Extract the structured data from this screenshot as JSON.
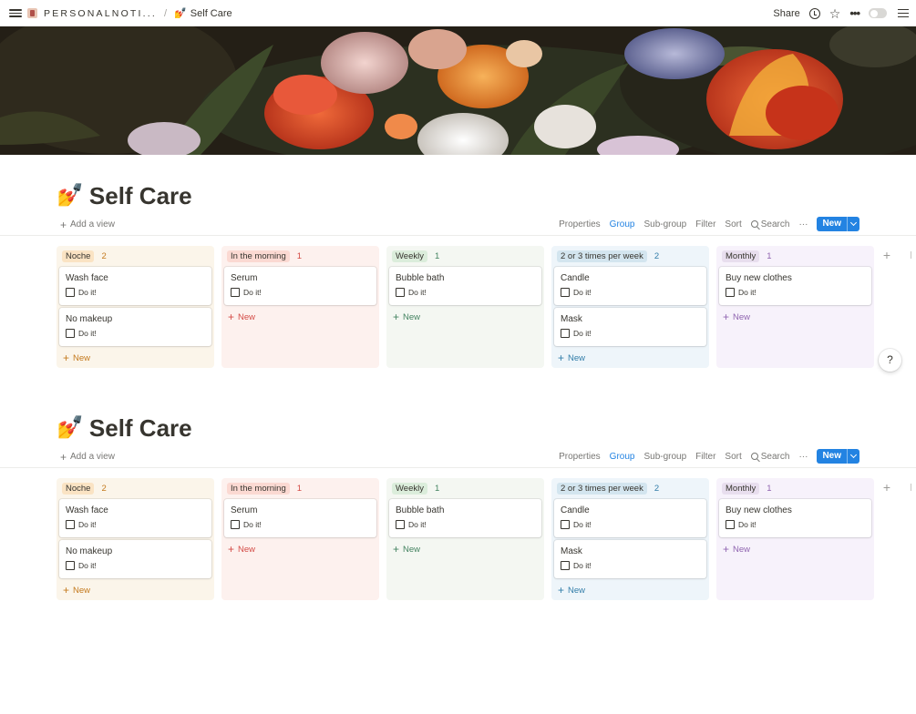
{
  "topbar": {
    "workspace": "PERSONALNOTI...",
    "separator": "/",
    "page_emoji": "💅",
    "page": "Self Care",
    "share": "Share",
    "more": "•••"
  },
  "sections": [
    {
      "emoji": "💅",
      "title": "Self Care",
      "add_view": "Add a view",
      "toolbar": {
        "properties": "Properties",
        "group": "Group",
        "subgroup": "Sub-group",
        "filter": "Filter",
        "sort": "Sort",
        "search": "Search",
        "more": "···",
        "new": "New"
      },
      "columns": [
        {
          "name": "Noche",
          "count": "2",
          "cards": [
            {
              "name": "Wash face",
              "check": "Do it!"
            },
            {
              "name": "No makeup",
              "check": "Do it!"
            }
          ],
          "new": "New"
        },
        {
          "name": "In the morning",
          "count": "1",
          "cards": [
            {
              "name": "Serum",
              "check": "Do it!"
            }
          ],
          "new": "New"
        },
        {
          "name": "Weekly",
          "count": "1",
          "cards": [
            {
              "name": "Bubble bath",
              "check": "Do it!"
            }
          ],
          "new": "New"
        },
        {
          "name": "2 or 3 times per week",
          "count": "2",
          "cards": [
            {
              "name": "Candle",
              "check": "Do it!"
            },
            {
              "name": "Mask",
              "check": "Do it!"
            }
          ],
          "new": "New"
        },
        {
          "name": "Monthly",
          "count": "1",
          "cards": [
            {
              "name": "Buy new clothes",
              "check": "Do it!"
            }
          ],
          "new": "New"
        }
      ]
    },
    {
      "emoji": "💅",
      "title": "Self Care",
      "add_view": "Add a view",
      "toolbar": {
        "properties": "Properties",
        "group": "Group",
        "subgroup": "Sub-group",
        "filter": "Filter",
        "sort": "Sort",
        "search": "Search",
        "more": "···",
        "new": "New"
      },
      "columns": [
        {
          "name": "Noche",
          "count": "2",
          "cards": [
            {
              "name": "Wash face",
              "check": "Do it!"
            },
            {
              "name": "No makeup",
              "check": "Do it!"
            }
          ],
          "new": "New"
        },
        {
          "name": "In the morning",
          "count": "1",
          "cards": [
            {
              "name": "Serum",
              "check": "Do it!"
            }
          ],
          "new": "New"
        },
        {
          "name": "Weekly",
          "count": "1",
          "cards": [
            {
              "name": "Bubble bath",
              "check": "Do it!"
            }
          ],
          "new": "New"
        },
        {
          "name": "2 or 3 times per week",
          "count": "2",
          "cards": [
            {
              "name": "Candle",
              "check": "Do it!"
            },
            {
              "name": "Mask",
              "check": "Do it!"
            }
          ],
          "new": "New"
        },
        {
          "name": "Monthly",
          "count": "1",
          "cards": [
            {
              "name": "Buy new clothes",
              "check": "Do it!"
            }
          ],
          "new": "New"
        }
      ]
    }
  ],
  "column_colors": [
    {
      "bg": "#fbf5ea",
      "tag": "#fae3c3",
      "text": "#c47a1e"
    },
    {
      "bg": "#fdf1ee",
      "tag": "#fbd9d2",
      "text": "#d44c47"
    },
    {
      "bg": "#f4f7f2",
      "tag": "#dbeddb",
      "text": "#448361"
    },
    {
      "bg": "#eef5fa",
      "tag": "#d3e5ef",
      "text": "#337ea9"
    },
    {
      "bg": "#f7f2fb",
      "tag": "#e8deee",
      "text": "#9065b0"
    }
  ],
  "accent": "#2383e2",
  "help": "?"
}
